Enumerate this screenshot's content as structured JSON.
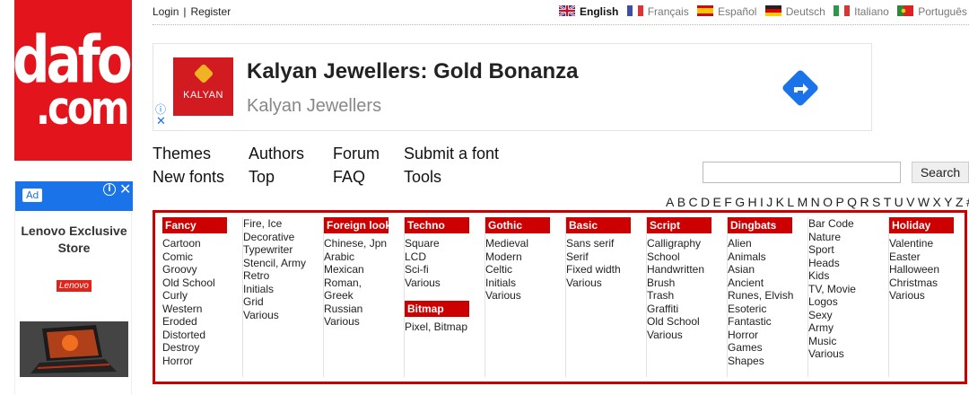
{
  "logo": {
    "line1": "dafont",
    "line2": ".com"
  },
  "top": {
    "login": "Login",
    "separator": "|",
    "register": "Register",
    "languages": [
      {
        "label": "English",
        "active": true
      },
      {
        "label": "Français",
        "active": false
      },
      {
        "label": "Español",
        "active": false
      },
      {
        "label": "Deutsch",
        "active": false
      },
      {
        "label": "Italiano",
        "active": false
      },
      {
        "label": "Português",
        "active": false
      }
    ]
  },
  "banner": {
    "logo_text": "KALYAN",
    "title": "Kalyan Jewellers: Gold Bonanza",
    "subtitle": "Kalyan Jewellers",
    "info_icon": "info-icon",
    "close_icon": "close-icon",
    "cta_icon": "directions-arrow-icon"
  },
  "sidead": {
    "tag": "Ad",
    "title": "Lenovo Exclusive Store",
    "brand": "Lenovo"
  },
  "nav": {
    "themes": "Themes",
    "authors": "Authors",
    "forum": "Forum",
    "submit": "Submit a font",
    "new_fonts": "New fonts",
    "top": "Top",
    "faq": "FAQ",
    "tools": "Tools"
  },
  "search": {
    "button": "Search",
    "value": ""
  },
  "alphabet": [
    "A",
    "B",
    "C",
    "D",
    "E",
    "F",
    "G",
    "H",
    "I",
    "J",
    "K",
    "L",
    "M",
    "N",
    "O",
    "P",
    "Q",
    "R",
    "S",
    "T",
    "U",
    "V",
    "W",
    "X",
    "Y",
    "Z",
    "#"
  ],
  "categories": [
    {
      "head": "Fancy",
      "items": [
        "Cartoon",
        "Comic",
        "Groovy",
        "Old School",
        "Curly",
        "Western",
        "Eroded",
        "Distorted",
        "Destroy",
        "Horror"
      ]
    },
    {
      "head": "",
      "items": [
        "Fire, Ice",
        "Decorative",
        "Typewriter",
        "Stencil, Army",
        "Retro",
        "Initials",
        "Grid",
        "Various"
      ]
    },
    {
      "head": "Foreign look",
      "items": [
        "Chinese, Jpn",
        "Arabic",
        "Mexican",
        "Roman,",
        "Greek",
        "Russian",
        "Various"
      ]
    },
    {
      "head": "Techno",
      "items": [
        "Square",
        "LCD",
        "Sci-fi",
        "Various"
      ],
      "sub_head": "Bitmap",
      "sub_items": [
        "Pixel, Bitmap"
      ]
    },
    {
      "head": "Gothic",
      "items": [
        "Medieval",
        "Modern",
        "Celtic",
        "Initials",
        "Various"
      ]
    },
    {
      "head": "Basic",
      "items": [
        "Sans serif",
        "Serif",
        "Fixed width",
        "Various"
      ]
    },
    {
      "head": "Script",
      "items": [
        "Calligraphy",
        "School",
        "Handwritten",
        "Brush",
        "Trash",
        "Graffiti",
        "Old School",
        "Various"
      ]
    },
    {
      "head": "Dingbats",
      "items": [
        "Alien",
        "Animals",
        "Asian",
        "Ancient",
        "Runes, Elvish",
        "Esoteric",
        "Fantastic",
        "Horror",
        "Games",
        "Shapes"
      ]
    },
    {
      "head": "",
      "items": [
        "Bar Code",
        "Nature",
        "Sport",
        "Heads",
        "Kids",
        "TV, Movie",
        "Logos",
        "Sexy",
        "Army",
        "Music",
        "Various"
      ]
    },
    {
      "head": "Holiday",
      "items": [
        "Valentine",
        "Easter",
        "Halloween",
        "Christmas",
        "Various"
      ]
    }
  ]
}
